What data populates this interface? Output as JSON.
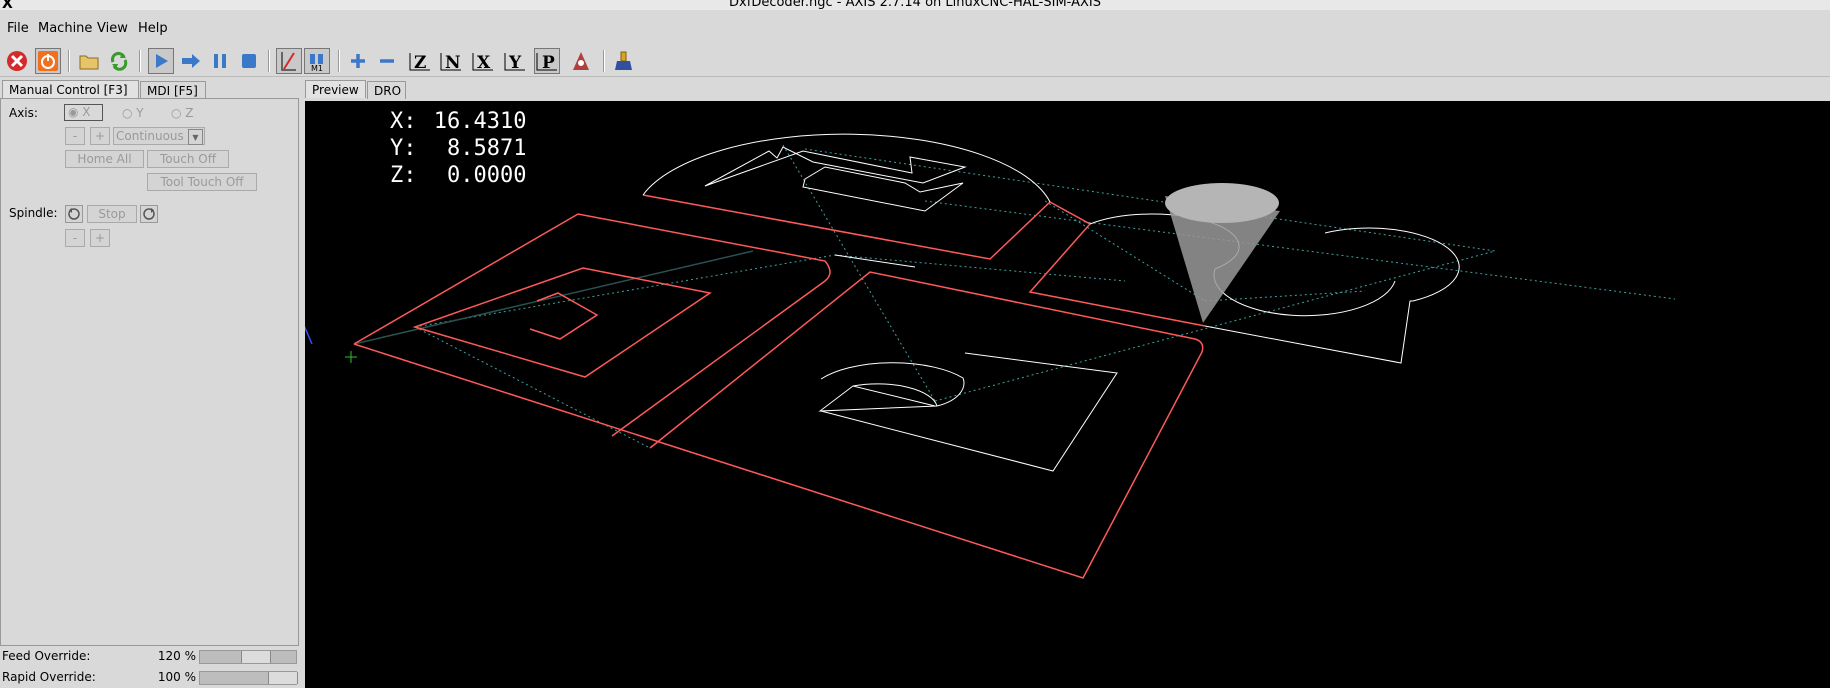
{
  "window": {
    "title": "DxfDecoder.ngc - AXIS 2.7.14 on LinuxCNC-HAL-SIM-AXIS"
  },
  "menu": {
    "items": [
      "File",
      "Machine",
      "View",
      "Help"
    ]
  },
  "toolbar": {
    "icons": [
      "estop-icon",
      "machine-power-icon",
      "open-file-icon",
      "reload-icon",
      "run-icon",
      "step-icon",
      "pause-icon",
      "stop-icon",
      "block-delete-icon",
      "optional-stop-icon",
      "zoom-in-icon",
      "zoom-out-icon",
      "view-z-icon",
      "view-z2-icon",
      "view-x-icon",
      "view-y-icon",
      "view-p-icon",
      "rotate-view-icon",
      "clear-plot-icon"
    ],
    "view_labels": {
      "z": "Z",
      "z2": "N",
      "x": "X",
      "y": "Y",
      "p": "P"
    }
  },
  "left_tabs": [
    {
      "label": "Manual Control [F3]"
    },
    {
      "label": "MDI [F5]"
    }
  ],
  "right_tabs": [
    {
      "label": "Preview"
    },
    {
      "label": "DRO"
    }
  ],
  "manual": {
    "axis_label": "Axis:",
    "axes": [
      "X",
      "Y",
      "Z"
    ],
    "selected_axis": "X",
    "jog_minus": "-",
    "jog_plus": "+",
    "jog_mode": "Continuous",
    "home_all": "Home All",
    "touch_off": "Touch Off",
    "tool_touch_off": "Tool Touch Off",
    "spindle_label": "Spindle:",
    "spindle_stop": "Stop",
    "spindle_minus": "-",
    "spindle_plus": "+"
  },
  "dro": [
    {
      "axis": "X:",
      "value": "16.4310"
    },
    {
      "axis": "Y:",
      "value": "8.5871"
    },
    {
      "axis": "Z:",
      "value": "0.0000"
    }
  ],
  "overrides": [
    {
      "label": "Feed Override:",
      "value": "120 %",
      "fraction": 0.6
    },
    {
      "label": "Rapid Override:",
      "value": "100 %",
      "fraction": 1.0
    }
  ],
  "colors": {
    "feed_path": "#ff5a5a",
    "rapid_path": "#3fa0a0",
    "outline": "#ffffff",
    "preview_bg": "#000000"
  }
}
